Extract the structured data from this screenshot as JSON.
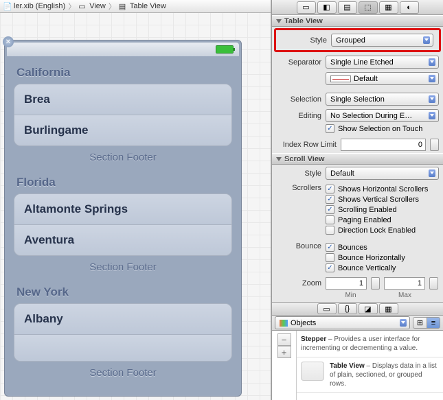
{
  "breadcrumb": {
    "file": "ler.xib (English)",
    "view": "View",
    "tableview": "Table View"
  },
  "preview": {
    "sections": [
      {
        "header": "California",
        "cells": [
          "Brea",
          "Burlingame"
        ],
        "footer": "Section Footer"
      },
      {
        "header": "Florida",
        "cells": [
          "Altamonte Springs",
          "Aventura"
        ],
        "footer": "Section Footer"
      },
      {
        "header": "New York",
        "cells": [
          "Albany",
          ""
        ],
        "footer": "Section Footer"
      }
    ]
  },
  "inspector": {
    "tableview_title": "Table View",
    "style_label": "Style",
    "style_value": "Grouped",
    "separator_label": "Separator",
    "separator_value": "Single Line Etched",
    "separator_color": "Default",
    "selection_label": "Selection",
    "selection_value": "Single Selection",
    "editing_label": "Editing",
    "editing_value": "No Selection During E…",
    "show_selection_label": "Show Selection on Touch",
    "show_selection_checked": true,
    "index_row_limit_label": "Index Row Limit",
    "index_row_limit_value": "0",
    "scrollview_title": "Scroll View",
    "sv_style_label": "Style",
    "sv_style_value": "Default",
    "scrollers_label": "Scrollers",
    "opt_hscrollers": "Shows Horizontal Scrollers",
    "opt_vscrollers": "Shows Vertical Scrollers",
    "opt_scrolling": "Scrolling Enabled",
    "opt_paging": "Paging Enabled",
    "opt_dirlock": "Direction Lock Enabled",
    "bounce_label": "Bounce",
    "opt_bounces": "Bounces",
    "opt_bounceh": "Bounce Horizontally",
    "opt_bouncev": "Bounce Vertically",
    "zoom_label": "Zoom",
    "zoom_min": "1",
    "zoom_max": "1",
    "min_label": "Min",
    "max_label": "Max"
  },
  "library": {
    "filter": "Objects",
    "stepper_title": "Stepper",
    "stepper_desc": " – Provides a user interface for incrementing or decrementing a value.",
    "tableview_title": "Table View",
    "tableview_desc": " – Displays data in a list of plain, sectioned, or grouped rows."
  }
}
